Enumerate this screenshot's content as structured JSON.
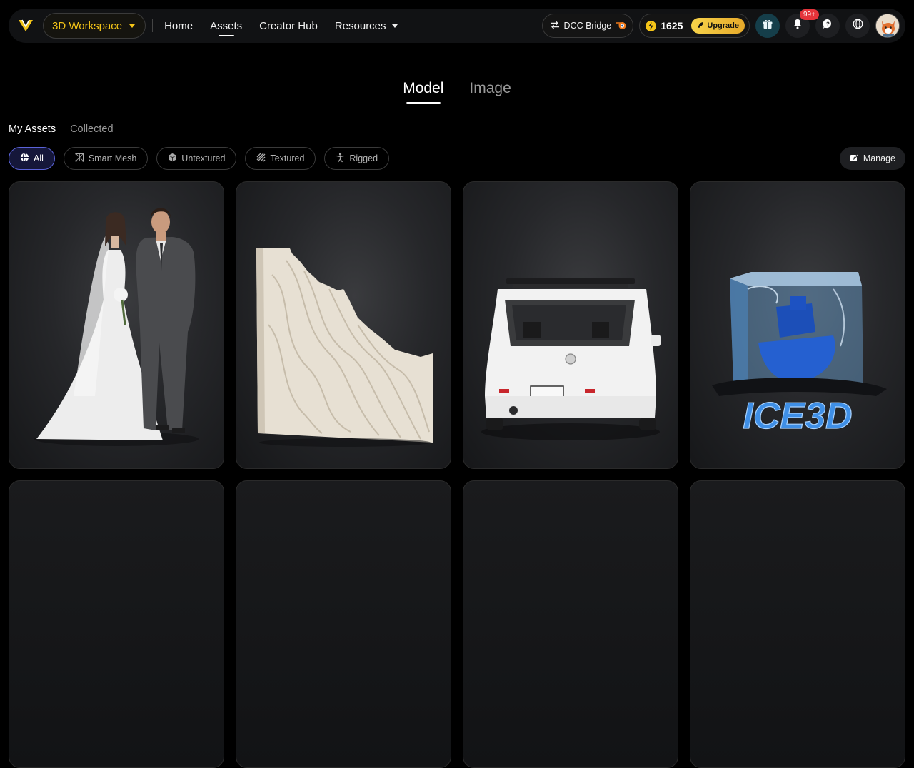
{
  "header": {
    "workspace_label": "3D Workspace",
    "nav": [
      {
        "label": "Home"
      },
      {
        "label": "Assets"
      },
      {
        "label": "Creator Hub"
      },
      {
        "label": "Resources"
      }
    ],
    "dcc_label": "DCC Bridge",
    "credits": "1625",
    "upgrade_label": "Upgrade",
    "notification_badge": "99+"
  },
  "type_tabs": [
    {
      "label": "Model"
    },
    {
      "label": "Image"
    }
  ],
  "sub_tabs": [
    {
      "label": "My Assets"
    },
    {
      "label": "Collected"
    }
  ],
  "filters": [
    {
      "label": "All",
      "icon": "globe-icon"
    },
    {
      "label": "Smart Mesh",
      "icon": "mesh-icon"
    },
    {
      "label": "Untextured",
      "icon": "cube-icon"
    },
    {
      "label": "Textured",
      "icon": "texture-icon"
    },
    {
      "label": "Rigged",
      "icon": "rigged-figure-icon"
    }
  ],
  "manage_label": "Manage",
  "assets": [
    {
      "name": "wedding-couple-model"
    },
    {
      "name": "carved-wall-panel-model"
    },
    {
      "name": "white-suv-model"
    },
    {
      "name": "ice3d-cube-model",
      "text": "ICE3D"
    }
  ],
  "colors": {
    "accent": "#f5c518",
    "active_chip_border": "#5b63d9",
    "badge": "#e5343b"
  }
}
